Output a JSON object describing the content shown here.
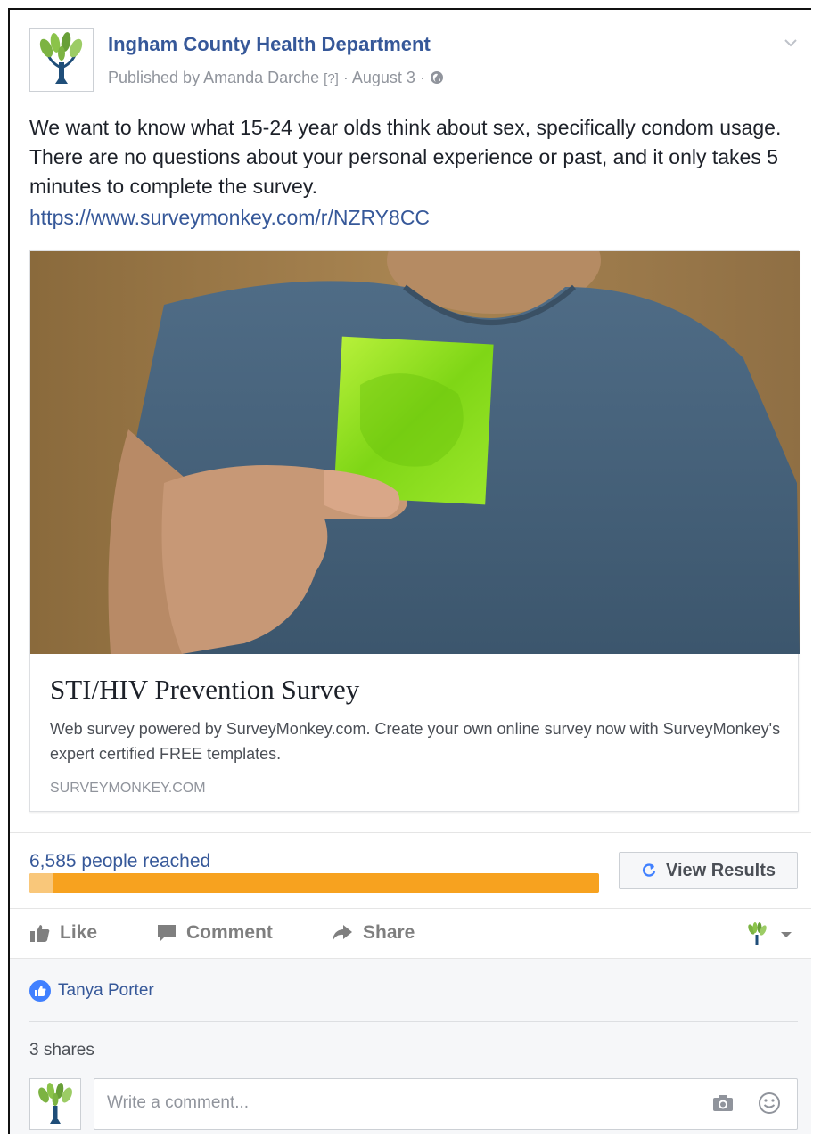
{
  "post": {
    "page_name": "Ingham County Health Department",
    "published_by": "Published by Amanda Darche",
    "help_marker": "[?]",
    "separator": "·",
    "date": "August 3",
    "text": "We want to know what 15-24 year olds think about sex, specifically condom usage. There are no questions about your personal experience or past, and it only takes 5 minutes to complete the survey.",
    "link_text": "https://www.surveymonkey.com/r/NZRY8CC"
  },
  "link_preview": {
    "image_description": "person-holding-green-condom-photo",
    "title": "STI/HIV Prevention Survey",
    "description": "Web survey powered by SurveyMonkey.com. Create your own online survey now with SurveyMonkey's expert certified FREE templates.",
    "domain": "SURVEYMONKEY.COM"
  },
  "insights": {
    "reached_label": "6,585 people reached",
    "organic_fraction": 0.04,
    "view_results_label": "View Results"
  },
  "actions": {
    "like": "Like",
    "comment": "Comment",
    "share": "Share"
  },
  "reactions": {
    "liker_name": "Tanya Porter",
    "shares": "3 shares"
  },
  "comment_box": {
    "placeholder": "Write a comment..."
  },
  "colors": {
    "link_blue": "#365899",
    "paid_orange": "#f7a21f",
    "organic_orange_light": "#f9c77a",
    "like_blue": "#4080ff",
    "logo_green": "#7cb342",
    "logo_navy": "#1f4e79"
  }
}
